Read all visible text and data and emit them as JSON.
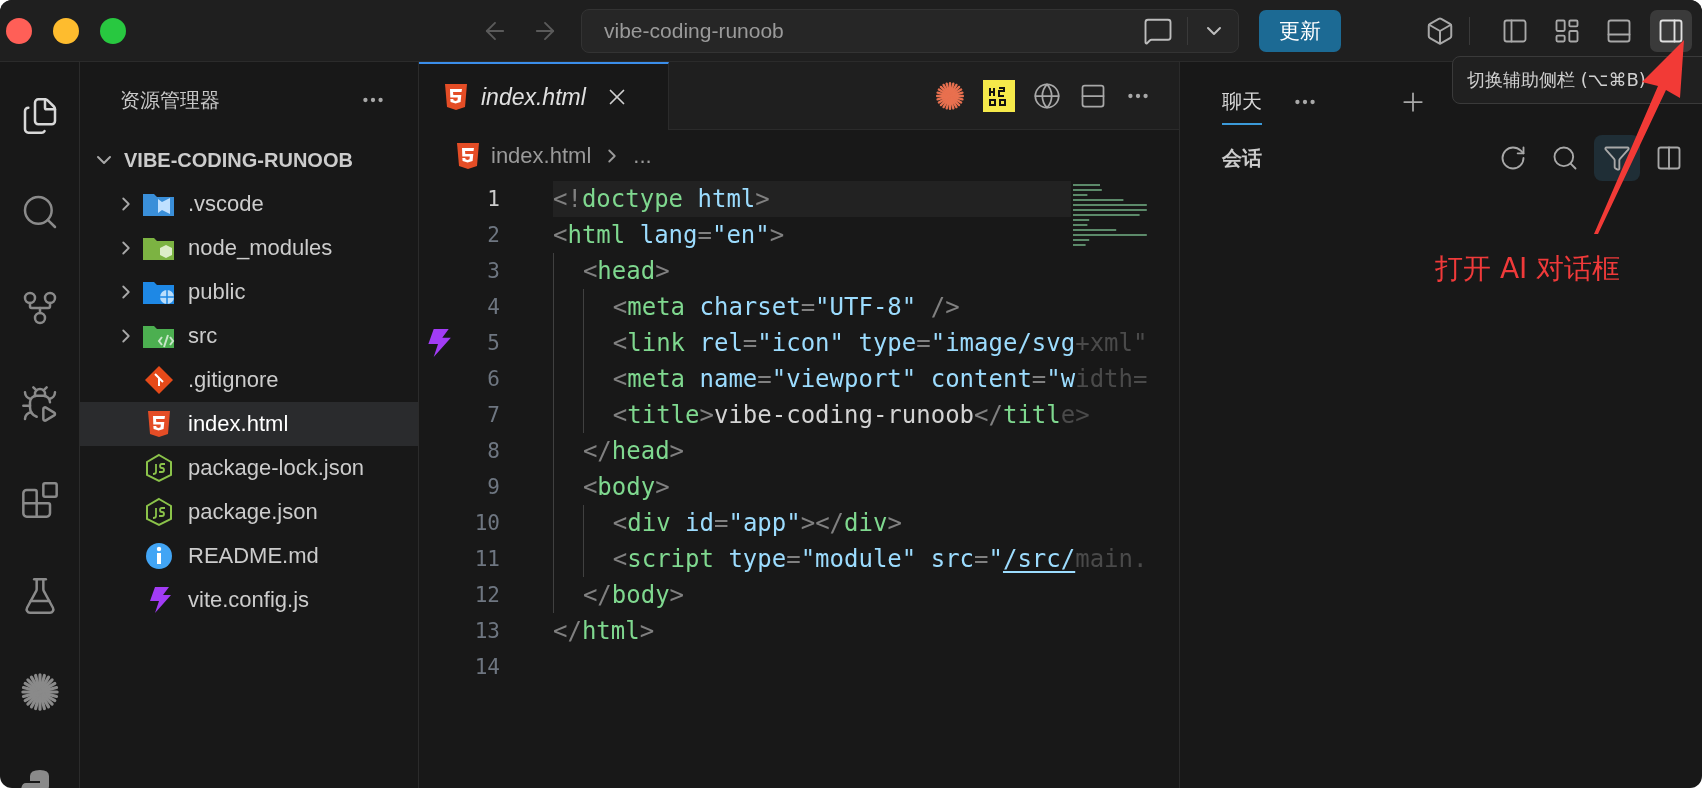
{
  "titlebar": {
    "search": {
      "value": "vibe-coding-runoob"
    },
    "update_button": "更新",
    "layout_buttons": [
      {
        "kind": "panel-left",
        "selected": false
      },
      {
        "kind": "layout",
        "selected": false
      },
      {
        "kind": "panel-bottom",
        "selected": false
      },
      {
        "kind": "panel-right",
        "selected": true
      }
    ]
  },
  "activity_bar": [
    {
      "kind": "files",
      "selected": true
    },
    {
      "kind": "search",
      "selected": false
    },
    {
      "kind": "source-control",
      "selected": false
    },
    {
      "kind": "run-debug",
      "selected": false
    },
    {
      "kind": "extensions",
      "selected": false
    },
    {
      "kind": "testing",
      "selected": false
    },
    {
      "kind": "starburst",
      "selected": false
    },
    {
      "kind": "python",
      "selected": false
    }
  ],
  "explorer": {
    "title": "资源管理器",
    "root": {
      "label": "VIBE-CODING-RUNOOB",
      "expanded": true
    },
    "items": [
      {
        "label": ".vscode",
        "kind": "folder-vscode",
        "expanded": false,
        "selected": false
      },
      {
        "label": "node_modules",
        "kind": "folder-node",
        "expanded": false,
        "selected": false
      },
      {
        "label": "public",
        "kind": "folder-public",
        "expanded": false,
        "selected": false
      },
      {
        "label": "src",
        "kind": "folder-src",
        "expanded": false,
        "selected": false
      },
      {
        "label": ".gitignore",
        "kind": "git",
        "selected": false
      },
      {
        "label": "index.html",
        "kind": "html",
        "selected": true
      },
      {
        "label": "package-lock.json",
        "kind": "json",
        "selected": false
      },
      {
        "label": "package.json",
        "kind": "json",
        "selected": false
      },
      {
        "label": "README.md",
        "kind": "info",
        "selected": false
      },
      {
        "label": "vite.config.js",
        "kind": "vite",
        "selected": false
      }
    ]
  },
  "editor": {
    "tabs": [
      {
        "label": "index.html",
        "kind": "html",
        "selected": true
      }
    ],
    "breadcrumb": [
      "index.html",
      "..."
    ],
    "lines": [
      {
        "number": "1",
        "current": true,
        "tokens": [
          {
            "kind": "punct",
            "text": "<!"
          },
          {
            "kind": "tag",
            "text": "doctype"
          },
          {
            "kind": "attr",
            "text": " html"
          },
          {
            "kind": "punct",
            "text": ">"
          }
        ]
      },
      {
        "number": "2",
        "current": false,
        "tokens": [
          {
            "kind": "punct",
            "text": "<"
          },
          {
            "kind": "tag",
            "text": "html"
          },
          {
            "kind": "attr",
            "text": " lang"
          },
          {
            "kind": "punct",
            "text": "="
          },
          {
            "kind": "string",
            "text": "\"en\""
          },
          {
            "kind": "punct",
            "text": ">"
          }
        ]
      },
      {
        "number": "3",
        "current": false,
        "tokens": [
          {
            "kind": "punct",
            "text": "  <"
          },
          {
            "kind": "tag",
            "text": "head"
          },
          {
            "kind": "punct",
            "text": ">"
          }
        ]
      },
      {
        "number": "4",
        "current": false,
        "tokens": [
          {
            "kind": "punct",
            "text": "    <"
          },
          {
            "kind": "tag",
            "text": "meta"
          },
          {
            "kind": "attr",
            "text": " charset"
          },
          {
            "kind": "punct",
            "text": "="
          },
          {
            "kind": "string",
            "text": "\"UTF-8\""
          },
          {
            "kind": "punct",
            "text": " />"
          }
        ]
      },
      {
        "number": "5",
        "current": false,
        "gutter_mark": true,
        "tokens": [
          {
            "kind": "punct",
            "text": "    <"
          },
          {
            "kind": "tag",
            "text": "link"
          },
          {
            "kind": "attr",
            "text": " rel"
          },
          {
            "kind": "punct",
            "text": "="
          },
          {
            "kind": "string",
            "text": "\"icon\""
          },
          {
            "kind": "attr",
            "text": " type"
          },
          {
            "kind": "punct",
            "text": "="
          },
          {
            "kind": "string",
            "text": "\"image/svg"
          },
          {
            "kind": "faded",
            "text": "+xml\""
          }
        ]
      },
      {
        "number": "6",
        "current": false,
        "tokens": [
          {
            "kind": "punct",
            "text": "    <"
          },
          {
            "kind": "tag",
            "text": "meta"
          },
          {
            "kind": "attr",
            "text": " name"
          },
          {
            "kind": "punct",
            "text": "="
          },
          {
            "kind": "string",
            "text": "\"viewport\""
          },
          {
            "kind": "attr",
            "text": " content"
          },
          {
            "kind": "punct",
            "text": "="
          },
          {
            "kind": "string",
            "text": "\"w"
          },
          {
            "kind": "faded",
            "text": "idth="
          }
        ]
      },
      {
        "number": "7",
        "current": false,
        "tokens": [
          {
            "kind": "punct",
            "text": "    <"
          },
          {
            "kind": "tag",
            "text": "title"
          },
          {
            "kind": "punct",
            "text": ">"
          },
          {
            "kind": "text",
            "text": "vibe-coding-runoob"
          },
          {
            "kind": "punct",
            "text": "</"
          },
          {
            "kind": "tag",
            "text": "titl"
          },
          {
            "kind": "faded",
            "text": "e>"
          }
        ]
      },
      {
        "number": "8",
        "current": false,
        "tokens": [
          {
            "kind": "punct",
            "text": "  </"
          },
          {
            "kind": "tag",
            "text": "head"
          },
          {
            "kind": "punct",
            "text": ">"
          }
        ]
      },
      {
        "number": "9",
        "current": false,
        "tokens": [
          {
            "kind": "punct",
            "text": "  <"
          },
          {
            "kind": "tag",
            "text": "body"
          },
          {
            "kind": "punct",
            "text": ">"
          }
        ]
      },
      {
        "number": "10",
        "current": false,
        "tokens": [
          {
            "kind": "punct",
            "text": "    <"
          },
          {
            "kind": "tag",
            "text": "div"
          },
          {
            "kind": "attr",
            "text": " id"
          },
          {
            "kind": "punct",
            "text": "="
          },
          {
            "kind": "string",
            "text": "\"app\""
          },
          {
            "kind": "punct",
            "text": "></"
          },
          {
            "kind": "tag",
            "text": "div"
          },
          {
            "kind": "punct",
            "text": ">"
          }
        ]
      },
      {
        "number": "11",
        "current": false,
        "tokens": [
          {
            "kind": "punct",
            "text": "    <"
          },
          {
            "kind": "tag",
            "text": "script"
          },
          {
            "kind": "attr",
            "text": " type"
          },
          {
            "kind": "punct",
            "text": "="
          },
          {
            "kind": "string",
            "text": "\"module\""
          },
          {
            "kind": "attr",
            "text": " src"
          },
          {
            "kind": "punct",
            "text": "="
          },
          {
            "kind": "string",
            "text": "\""
          },
          {
            "kind": "link",
            "text": "/src/"
          },
          {
            "kind": "faded",
            "text": "main."
          }
        ]
      },
      {
        "number": "12",
        "current": false,
        "tokens": [
          {
            "kind": "punct",
            "text": "  </"
          },
          {
            "kind": "tag",
            "text": "body"
          },
          {
            "kind": "punct",
            "text": ">"
          }
        ]
      },
      {
        "number": "13",
        "current": false,
        "tokens": [
          {
            "kind": "punct",
            "text": "</"
          },
          {
            "kind": "tag",
            "text": "html"
          },
          {
            "kind": "punct",
            "text": ">"
          }
        ]
      },
      {
        "number": "14",
        "current": false
      }
    ]
  },
  "secondary_sidebar": {
    "tabs": [
      {
        "label": "聊天",
        "selected": true
      }
    ],
    "section": "会话",
    "tools": [
      {
        "kind": "refresh",
        "selected": false
      },
      {
        "kind": "search",
        "selected": false
      },
      {
        "kind": "filter",
        "selected": true
      },
      {
        "kind": "panel",
        "selected": false
      }
    ]
  },
  "tooltip": "切换辅助侧栏 (⌥⌘B)",
  "annotation": "打开 AI 对话框"
}
